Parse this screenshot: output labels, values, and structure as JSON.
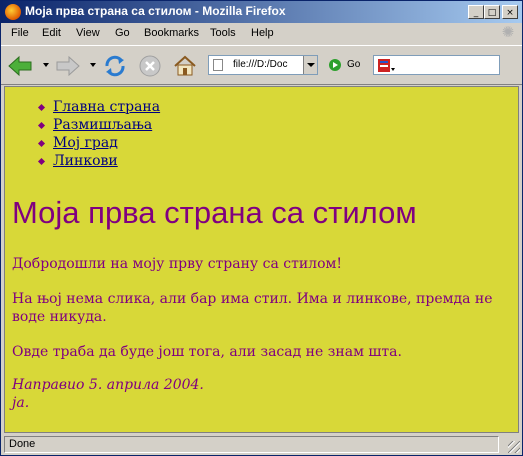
{
  "window": {
    "title": "Моја прва страна са стилом - Mozilla Firefox",
    "buttons": {
      "minimize": "_",
      "maximize": "□",
      "close": "×"
    }
  },
  "menu": [
    {
      "label": "File"
    },
    {
      "label": "Edit"
    },
    {
      "label": "View"
    },
    {
      "label": "Go"
    },
    {
      "label": "Bookmarks"
    },
    {
      "label": "Tools"
    },
    {
      "label": "Help"
    }
  ],
  "toolbar": {
    "address_value": "file:///D:/Doc",
    "go_label": "Go",
    "search_value": ""
  },
  "page": {
    "nav": [
      "Главна страна",
      "Размишљања",
      "Мој град",
      "Линкови"
    ],
    "heading": "Моја прва страна са стилом",
    "p1": "Добродошли на моју прву страну са стилом!",
    "p2": "На њој нема слика, али бар има стил. Има и линкове, премда не воде никуда.",
    "p3": "Овде траба да буде још тога, али засад не знам шта.",
    "signature_line1": "Направио 5. априла 2004.",
    "signature_line2": "ја."
  },
  "status": {
    "text": "Done"
  },
  "colors": {
    "page_background": "#d8d838",
    "text": "#800080",
    "link": "#000080",
    "chrome": "#d4d0c8"
  }
}
